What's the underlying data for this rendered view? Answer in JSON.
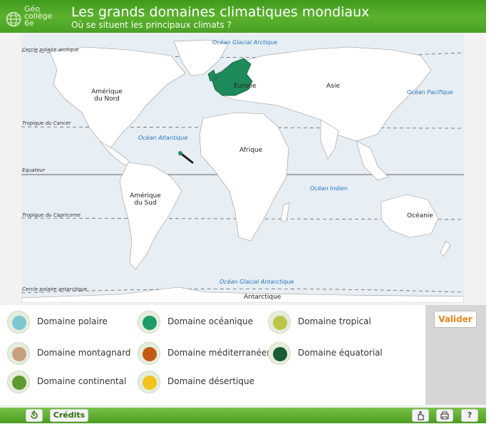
{
  "header": {
    "logo_line1": "Géo",
    "logo_line2": "collège",
    "logo_line3": "6e",
    "title": "Les grands domaines climatiques mondiaux",
    "subtitle": "Où se situent les principaux climats ?"
  },
  "map": {
    "oceans": {
      "arctic": "Océan Glacial Arctique",
      "pacific": "Océan Pacifique",
      "atlantic": "Océan Atlantique",
      "indian": "Océan Indien",
      "antarctic": "Océan Glacial Antarctique"
    },
    "lines": {
      "arctic_circle": "Cercle polaire arctique",
      "cancer": "Tropique du Cancer",
      "equator": "Equateur",
      "capricorn": "Tropique du Capricorne",
      "antarctic_circle": "Cercle polaire antarctique"
    },
    "continents": {
      "north_america": "Amérique du Nord",
      "south_america": "Amérique du Sud",
      "europe": "Europe",
      "asia": "Asie",
      "africa": "Afrique",
      "oceania": "Océanie",
      "antarctica": "Antarctique"
    },
    "colors": {
      "europe_fill": "#1f8a5a",
      "land": "#ffffff",
      "sea": "#e7eef4"
    }
  },
  "legend": [
    {
      "label": "Domaine polaire",
      "color": "#7fc6d3"
    },
    {
      "label": "Domaine océanique",
      "color": "#1f9b67"
    },
    {
      "label": "Domaine tropical",
      "color": "#bcc54a"
    },
    {
      "label": "Domaine montagnard",
      "color": "#c9a07f"
    },
    {
      "label": "Domaine méditerranéen",
      "color": "#c25a14"
    },
    {
      "label": "Domaine équatorial",
      "color": "#1d5a35"
    },
    {
      "label": "Domaine continental",
      "color": "#5e9a2f"
    },
    {
      "label": "Domaine désertique",
      "color": "#f2c21e"
    }
  ],
  "side": {
    "valider": "Valider"
  },
  "footer": {
    "credits": "Crédits"
  }
}
